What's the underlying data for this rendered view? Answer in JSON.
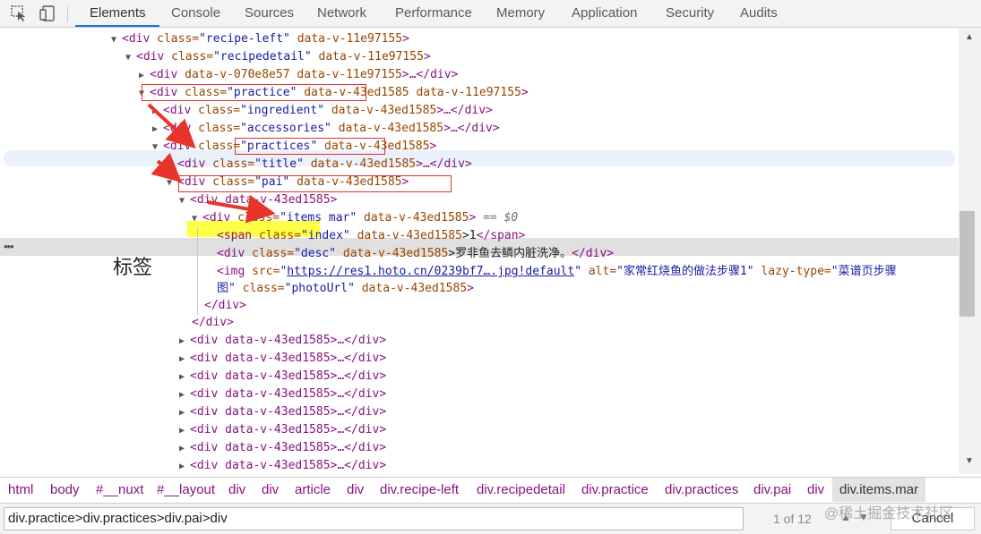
{
  "toolbar": {
    "inspect_icon": "inspect-cursor-icon",
    "device_icon": "device-toggle-icon",
    "tabs": [
      "Elements",
      "Console",
      "Sources",
      "Network",
      "Performance",
      "Memory",
      "Application",
      "Security",
      "Audits"
    ],
    "active_tab": "Elements",
    "accent_color": "#1a73e8"
  },
  "tree": {
    "recipe_left": {
      "tag": "<div",
      "attr": "class=",
      "class": "\"recipe-left\"",
      "scope": "data-v-11e97155",
      "close": ">"
    },
    "recipedetail": {
      "tag": "<div",
      "attr": "class=",
      "class": "\"recipedetail\"",
      "scope": "data-v-11e97155",
      "close": ">"
    },
    "child070": {
      "tag": "<div",
      "scope": "data-v-070e8e57",
      "scope2": "data-v-11e97155",
      "tail": ">…</div>"
    },
    "practice": {
      "tag": "<div",
      "attr": "class=",
      "class": "\"practice\"",
      "scope": "data-v-43ed1585",
      "scope2": "data-v-11e97155",
      "close": ">"
    },
    "ingredient": {
      "tag": "<div",
      "attr": "class=",
      "class": "\"ingredient\"",
      "scope": "data-v-43ed1585",
      "tail": ">…</div>"
    },
    "accessories": {
      "tag": "<div",
      "attr": "class=",
      "class": "\"accessories\"",
      "scope": "data-v-43ed1585",
      "tail": ">…</div>"
    },
    "practices": {
      "tag": "<div",
      "attr": "class=",
      "class": "\"practices\"",
      "scope": "data-v-43ed1585",
      "close": ">"
    },
    "title": {
      "tag": "<div",
      "attr": "class=",
      "class": "\"title\"",
      "scope": "data-v-43ed1585",
      "tail": ">…</div>"
    },
    "pai": {
      "tag": "<div",
      "attr": "class=",
      "class": "\"pai\"",
      "scope": "data-v-43ed1585",
      "close": ">"
    },
    "pai_child": {
      "text": "<div data-v-43ed1585>"
    },
    "items": {
      "tag": "<div",
      "attr": "class=",
      "class": "\"items mar\"",
      "scope": "data-v-43ed1585",
      "close": ">",
      "eq": "== $0"
    },
    "index_span": {
      "tag": "<span",
      "attr": "class=",
      "class": "\"index\"",
      "scope": "data-v-43ed1585",
      "text": ">1",
      "close": "</span>"
    },
    "desc_div": {
      "tag": "<div",
      "attr": "class=",
      "class": "\"desc\"",
      "scope": "data-v-43ed1585",
      "text": ">罗非鱼去鳞内脏洗净。",
      "close": "</div>"
    },
    "img": {
      "tag": "<img",
      "src_attr": "src=",
      "src_link": "https://res1.hoto.cn/0239bf7….jpg!default",
      "alt_attr": "alt=",
      "alt_val": "\"家常红烧鱼的做法步骤1\"",
      "lazy_attr": "lazy-type=",
      "lazy_val_1": "\"菜谱页步骤",
      "lazy_val_2": "图\"",
      "class_attr": "class=",
      "class_val": "\"photoUrl\"",
      "scope": "data-v-43ed1585",
      "close": ">"
    },
    "close_inner": "</div>",
    "close_outer": "</div>",
    "sibling_text": "<div data-v-43ed1585>…</div>",
    "sibling_count": 8
  },
  "annotation": {
    "label": "标签",
    "highlight_color": "#ffff44",
    "box_color": "#e0302a"
  },
  "breadcrumbs": [
    "html",
    "body",
    "#__nuxt",
    "#__layout",
    "div",
    "div",
    "article",
    "div",
    "div.recipe-left",
    "div.recipedetail",
    "div.practice",
    "div.practices",
    "div.pai",
    "div"
  ],
  "breadcrumb_current": "div.items.mar",
  "search": {
    "value": "div.practice>div.practices>div.pai>div",
    "match_count": "1 of 12",
    "cancel_label": "Cancel"
  },
  "watermark": "@稀土掘金技术社区"
}
